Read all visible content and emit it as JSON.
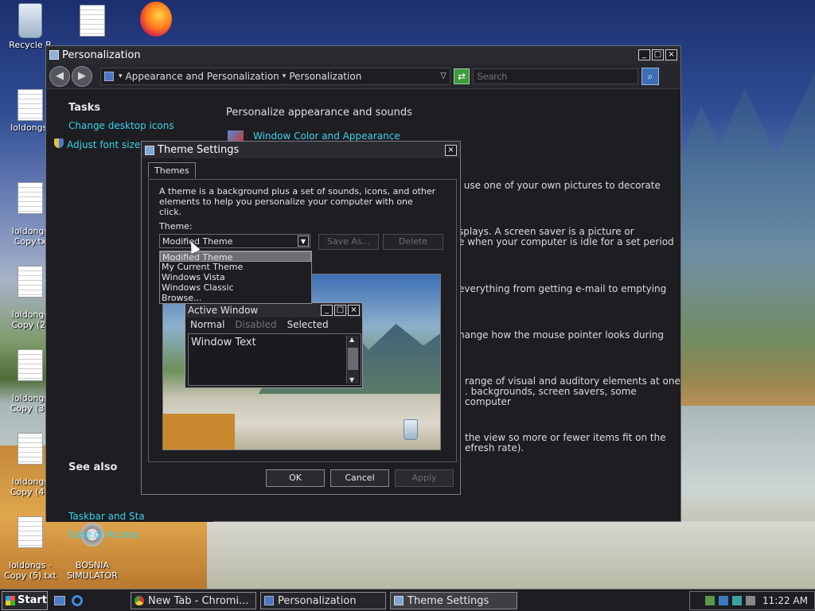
{
  "desktop": {
    "icons": [
      {
        "label": "Recycle B"
      },
      {
        "label": ""
      },
      {
        "label": ""
      },
      {
        "label": "loldongs."
      },
      {
        "label": "loldongs\nCopy.tx"
      },
      {
        "label": "loldongs\nCopy (2)"
      },
      {
        "label": "loldongs\nCopy (3)."
      },
      {
        "label": "loldongs\nCopy (4)."
      },
      {
        "label": "loldongs -\nCopy (5).txt"
      },
      {
        "label": "BOSNIA\nSIMULATOR"
      }
    ]
  },
  "personalization": {
    "title": "Personalization",
    "breadcrumb": [
      "Appearance and Personalization",
      "Personalization"
    ],
    "search_placeholder": "Search",
    "tasks_heading": "Tasks",
    "tasks": [
      "Change desktop icons",
      "Adjust font size"
    ],
    "see_also_heading": "See also",
    "see_also": [
      "Taskbar and Sta",
      "Ease of Access"
    ],
    "heading": "Personalize appearance and sounds",
    "first_link": "Window Color and Appearance",
    "snippets": [
      "r use one of your own pictures to decorate",
      "splays. A screen saver is a picture or",
      "e when your computer is idle for a set period",
      "everything from getting e-mail to emptying",
      "hange how the mouse pointer looks during",
      "range of visual and auditory elements at one",
      ". backgrounds, screen savers, some computer",
      "the view so more or fewer items fit on the",
      "efresh rate)."
    ]
  },
  "theme_settings": {
    "title": "Theme Settings",
    "tab": "Themes",
    "description": "A theme is a background plus a set of sounds, icons, and other elements to help you personalize your computer with one click.",
    "theme_label": "Theme:",
    "selected_theme": "Modified Theme",
    "save_as": "Save As...",
    "delete": "Delete",
    "options": [
      "Modified Theme",
      "My Current Theme",
      "Windows Vista",
      "Windows Classic",
      "Browse..."
    ],
    "preview": {
      "active_window_title": "Active Window",
      "menu": [
        "Normal",
        "Disabled",
        "Selected"
      ],
      "window_text": "Window Text"
    },
    "ok": "OK",
    "cancel": "Cancel",
    "apply": "Apply"
  },
  "taskbar": {
    "start": "Start",
    "tasks": [
      "New Tab - Chromi...",
      "Personalization",
      "Theme Settings"
    ],
    "clock": "11:22 AM"
  },
  "colors": {
    "link": "#3ad3e8",
    "window_bg": "#1d1d22"
  }
}
